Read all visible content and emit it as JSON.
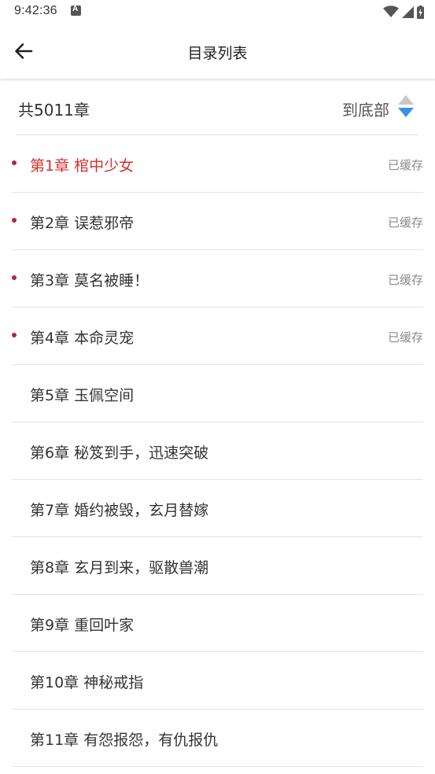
{
  "status_bar": {
    "time": "9:42:36"
  },
  "header": {
    "title": "目录列表"
  },
  "summary": {
    "count_text": "共5011章",
    "jump_label": "到底部"
  },
  "colors": {
    "current_chapter": "#d32f2f",
    "cached_dot": "#b3263a",
    "sort_active": "#3d8fe6",
    "sort_inactive": "#c8c8c8"
  },
  "chapters": [
    {
      "title": "第1章 棺中少女",
      "status": "已缓存",
      "current": true
    },
    {
      "title": "第2章 误惹邪帝",
      "status": "已缓存",
      "current": false
    },
    {
      "title": "第3章 莫名被睡！",
      "status": "已缓存",
      "current": false
    },
    {
      "title": "第4章 本命灵宠",
      "status": "已缓存",
      "current": false
    },
    {
      "title": "第5章 玉佩空间",
      "status": "",
      "current": false
    },
    {
      "title": "第6章 秘笈到手，迅速突破",
      "status": "",
      "current": false
    },
    {
      "title": "第7章 婚约被毁，玄月替嫁",
      "status": "",
      "current": false
    },
    {
      "title": "第8章 玄月到来，驱散兽潮",
      "status": "",
      "current": false
    },
    {
      "title": "第9章 重回叶家",
      "status": "",
      "current": false
    },
    {
      "title": "第10章 神秘戒指",
      "status": "",
      "current": false
    },
    {
      "title": "第11章 有怨报怨，有仇报仇",
      "status": "",
      "current": false
    }
  ]
}
